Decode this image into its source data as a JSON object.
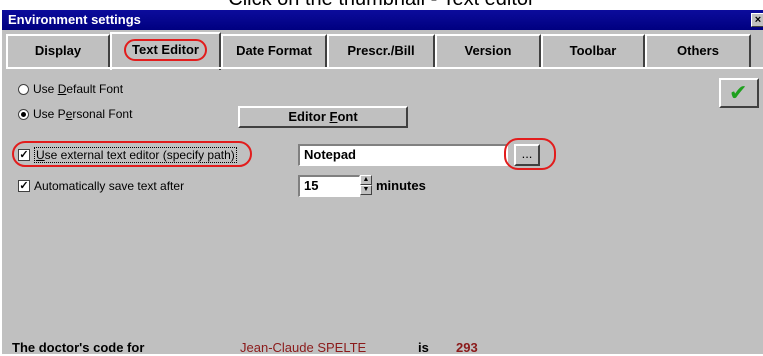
{
  "caption": "Click on the thumbnail - Text editor",
  "window": {
    "title": "Environment settings",
    "close_glyph": "×"
  },
  "tabs": [
    {
      "label": "Display"
    },
    {
      "label": "Text Editor",
      "active": true
    },
    {
      "label": "Date Format"
    },
    {
      "label": "Prescr./Bill"
    },
    {
      "label": "Version"
    },
    {
      "label": "Toolbar"
    },
    {
      "label": "Others"
    }
  ],
  "font_options": {
    "default_prefix": "Use ",
    "default_key": "D",
    "default_rest": "efault Font",
    "personal_prefix": "Use P",
    "personal_key": "e",
    "personal_rest": "rsonal Font",
    "selected": "personal"
  },
  "editor_font_button": {
    "prefix": "Editor ",
    "key": "F",
    "rest": "ont"
  },
  "external_editor": {
    "label_prefix": "",
    "key": "U",
    "label_rest": "se external text editor (specify path)",
    "checked": true,
    "value": "Notepad",
    "browse_label": "..."
  },
  "autosave": {
    "label": "Automatically save text after",
    "checked": true,
    "value": "15",
    "unit": "minutes"
  },
  "ok_button": {
    "icon": "check-icon",
    "glyph": "✔"
  },
  "footer": {
    "label": "The doctor's code for",
    "doctor_name": "Jean-Claude SPELTE",
    "connector": "is",
    "code": "293"
  },
  "colors": {
    "title_bar": "#000080",
    "highlight": "#e21c1c",
    "doctor_text": "#8b1a1a",
    "ok_check": "#1ea01e"
  }
}
